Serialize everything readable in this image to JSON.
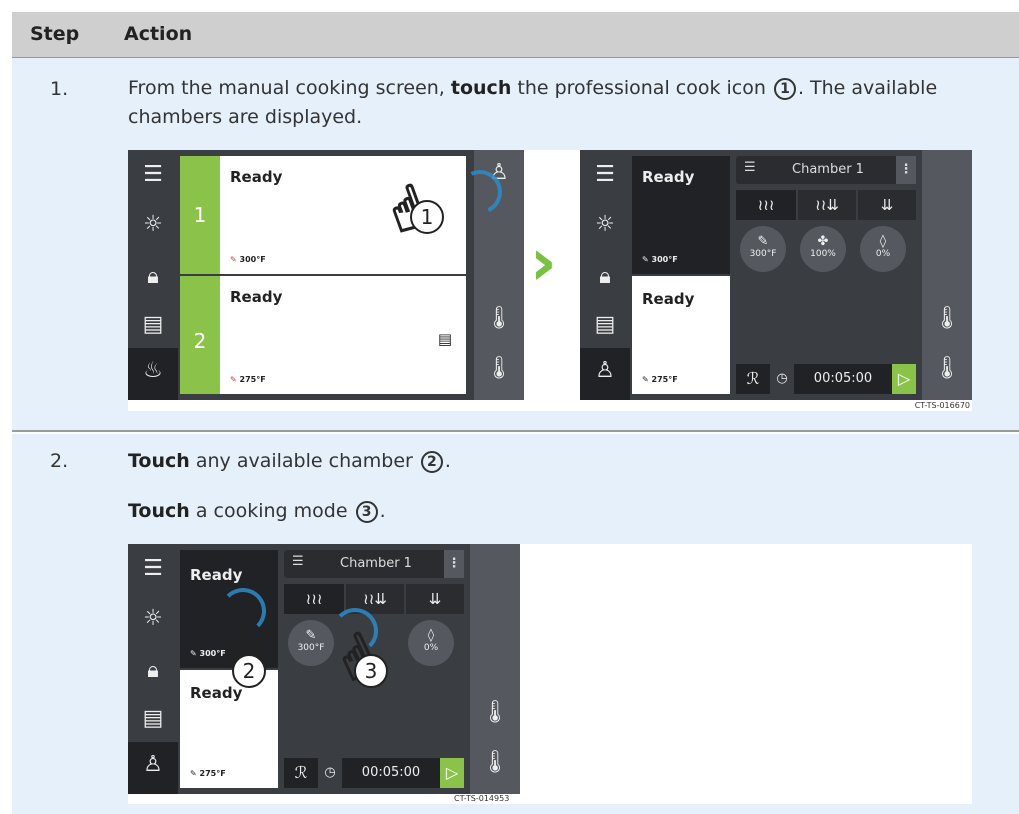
{
  "table": {
    "col_step": "Step",
    "col_action": "Action"
  },
  "steps": [
    {
      "number": "1.",
      "text_before": "From the manual cooking screen, ",
      "bold": "touch",
      "text_after": " the professional cook icon ",
      "circled": "1",
      "text_end": ". The available chambers are displayed."
    },
    {
      "number": "2.",
      "bold": "Touch",
      "text_after": " any available chamber ",
      "circled": "2",
      "text_end": "."
    },
    {
      "bold": "Touch",
      "text_after": " a cooking mode ",
      "circled": "3",
      "text_end": "."
    }
  ],
  "fig1": {
    "code": "CT-TS-016670",
    "left": {
      "c1_status": "Ready",
      "c1_num": "1",
      "c1_temp": "300°F",
      "c2_status": "Ready",
      "c2_num": "2",
      "c2_temp": "275°F",
      "callout": "1"
    },
    "right": {
      "c1_status": "Ready",
      "c1_temp": "300°F",
      "c2_status": "Ready",
      "c2_temp": "275°F",
      "chamber": "Chamber 1",
      "k1": "300°F",
      "k2": "100%",
      "k3": "0%",
      "timer": "00:05:00"
    }
  },
  "fig2": {
    "code": "CT-TS-014953",
    "c1_status": "Ready",
    "c1_temp": "300°F",
    "c2_status": "Ready",
    "c2_temp": "275°F",
    "chamber": "Chamber 1",
    "k1": "300°F",
    "k3": "0%",
    "timer": "00:05:00",
    "callout2": "2",
    "callout3": "3"
  },
  "colors": {
    "green": "#8bc34a",
    "panel": "#3a3d42",
    "row_bg": "#e6f0fb"
  }
}
